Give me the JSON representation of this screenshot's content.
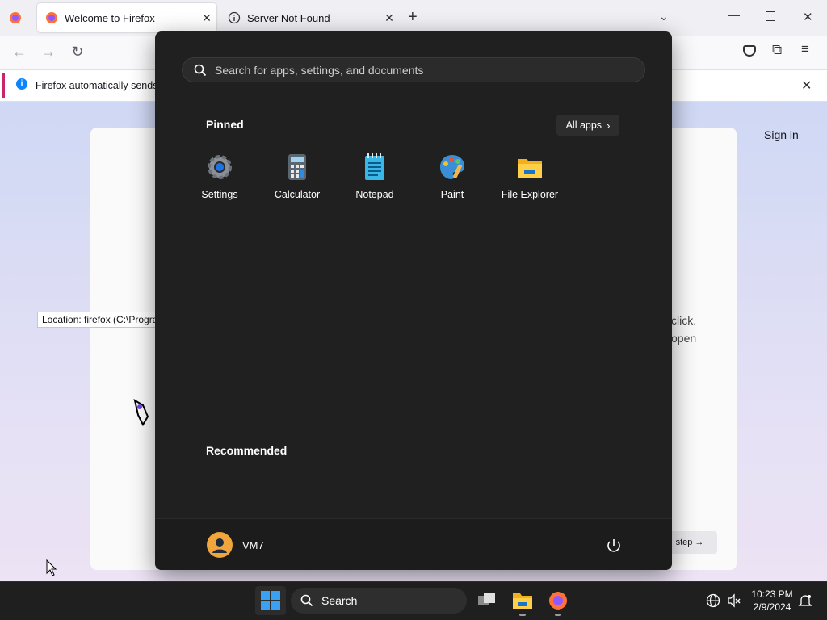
{
  "browser": {
    "tabs": [
      {
        "label": "Welcome to Firefox",
        "active": true
      },
      {
        "label": "Server Not Found",
        "active": false
      }
    ],
    "notification": "Firefox automatically sends",
    "sign_in": "Sign in",
    "page_fragments": {
      "line1": "click.",
      "line2": "open",
      "step_button": "step →"
    }
  },
  "tooltip": "Location: firefox (C:\\Progra",
  "start_menu": {
    "search_placeholder": "Search for apps, settings, and documents",
    "pinned_title": "Pinned",
    "all_apps_label": "All apps",
    "pinned_apps": [
      {
        "label": "Settings",
        "icon": "settings-gear-icon"
      },
      {
        "label": "Calculator",
        "icon": "calculator-icon"
      },
      {
        "label": "Notepad",
        "icon": "notepad-icon"
      },
      {
        "label": "Paint",
        "icon": "paint-palette-icon"
      },
      {
        "label": "File Explorer",
        "icon": "folder-icon"
      }
    ],
    "recommended_title": "Recommended",
    "user_name": "VM7"
  },
  "taskbar": {
    "search_label": "Search",
    "time": "10:23 PM",
    "date": "2/9/2024"
  },
  "colors": {
    "accent": "#0078d4",
    "start_bg": "#202020",
    "taskbar_bg": "#1f1f1f"
  }
}
